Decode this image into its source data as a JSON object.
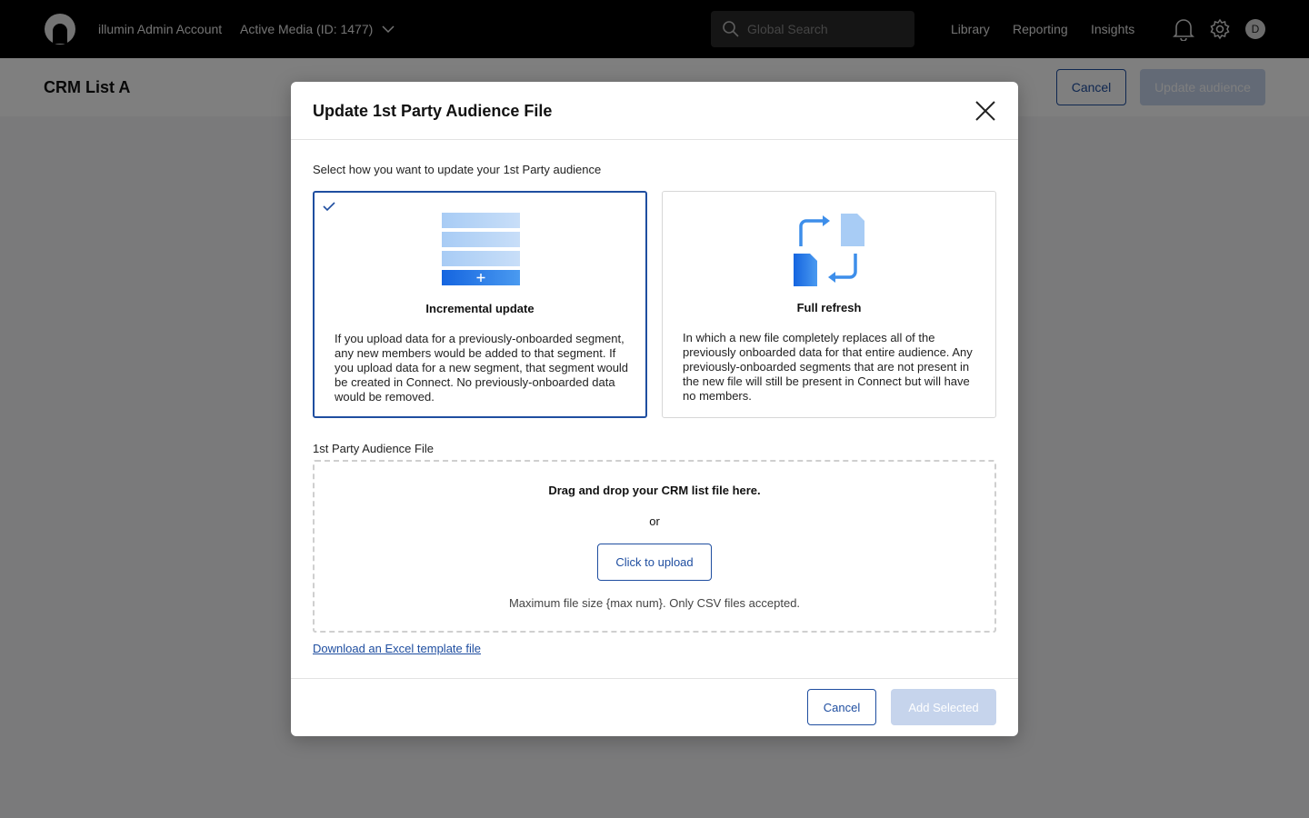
{
  "nav": {
    "account": "illumin Admin Account",
    "workspace": "Active Media (ID: 1477)",
    "search_placeholder": "Global Search",
    "links": [
      "Library",
      "Reporting",
      "Insights"
    ],
    "avatar_initial": "D"
  },
  "page": {
    "title": "CRM List A",
    "cancel_label": "Cancel",
    "update_label": "Update audience"
  },
  "modal": {
    "title": "Update 1st Party Audience File",
    "instruction": "Select how you want to update your 1st Party audience",
    "options": [
      {
        "title": "Incremental update",
        "selected": true,
        "description": "If you upload data for a previously-onboarded segment, any new members would be added to that segment. If you upload data for a new segment, that segment would be created in Connect. No previously-onboarded data would be removed."
      },
      {
        "title": "Full refresh",
        "selected": false,
        "description": "In which a new file completely replaces all of the previously onboarded data for that entire audience. Any previously-onboarded segments that are not present in the new file will still be present in Connect but will have no members."
      }
    ],
    "file_label": "1st Party Audience File",
    "dropzone": {
      "title": "Drag and drop your CRM list file here.",
      "or": "or",
      "upload_label": "Click to upload",
      "note": "Maximum file size {max num}. Only CSV files accepted."
    },
    "template_link": "Download an Excel template file",
    "cancel_label": "Cancel",
    "add_label": "Add Selected"
  },
  "colors": {
    "primary": "#1f4ea0",
    "disabled": "#c6d4ec",
    "nav_bg": "#000000"
  },
  "icons": [
    "logo-icon",
    "chevron-down-icon",
    "search-icon",
    "bell-icon",
    "gear-icon",
    "close-icon",
    "check-icon",
    "stack-plus-icon",
    "refresh-files-icon"
  ]
}
